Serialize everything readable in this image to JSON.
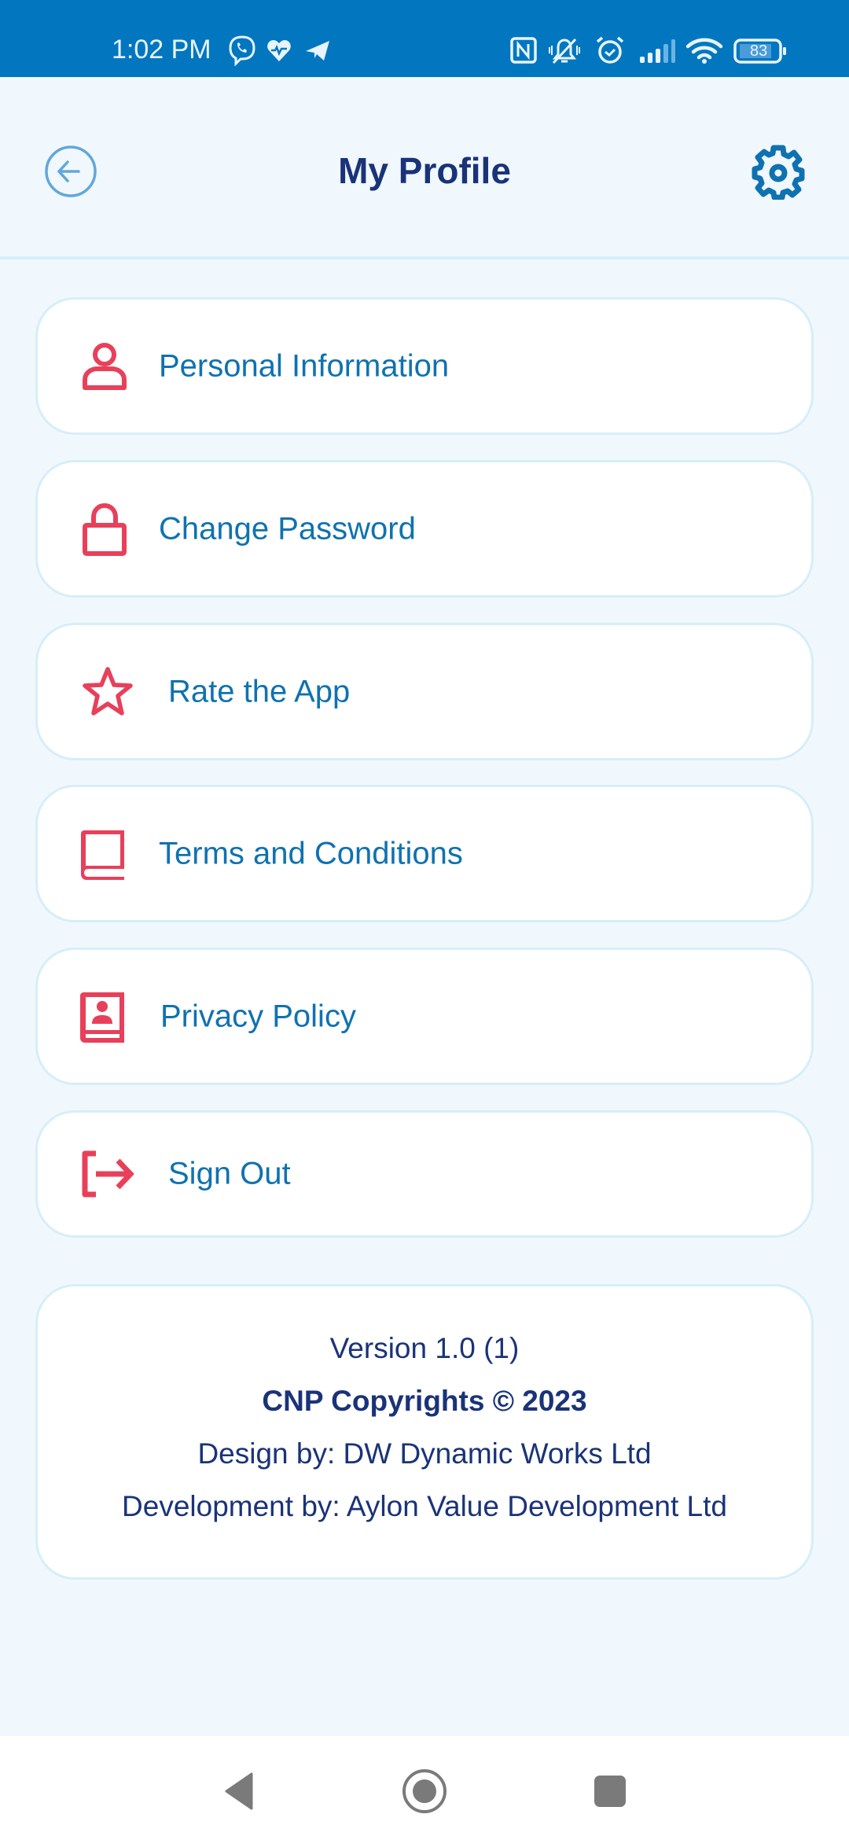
{
  "status_bar": {
    "time": "1:02 PM",
    "left_icons": [
      "viber-icon",
      "health-heart-icon",
      "telegram-icon"
    ],
    "right_icons": [
      "nfc-icon",
      "bell-muted-icon",
      "alarm-icon",
      "signal-icon",
      "wifi-icon",
      "battery-icon"
    ],
    "battery_level": "83",
    "background_color": "#0277c0"
  },
  "header": {
    "title": "My Profile",
    "back_icon": "arrow-left-circle-icon",
    "settings_icon": "gear-icon"
  },
  "menu": {
    "items": [
      {
        "label": "Personal Information",
        "icon": "user-icon"
      },
      {
        "label": "Change Password",
        "icon": "lock-icon"
      },
      {
        "label": "Rate the App",
        "icon": "star-icon"
      },
      {
        "label": "Terms and Conditions",
        "icon": "book-icon"
      },
      {
        "label": "Privacy Policy",
        "icon": "contact-book-icon"
      },
      {
        "label": "Sign Out",
        "icon": "sign-out-icon"
      }
    ],
    "icon_color": "#e8405a",
    "label_color": "#0f72b0"
  },
  "footer": {
    "version": "Version 1.0 (1)",
    "copyright": "CNP Copyrights © 2023",
    "design_by": "Design by: DW Dynamic Works Ltd",
    "development_by": "Development by: Aylon Value Development Ltd"
  },
  "nav_bar": {
    "buttons": [
      "back-triangle-icon",
      "home-circle-icon",
      "recents-square-icon"
    ]
  }
}
